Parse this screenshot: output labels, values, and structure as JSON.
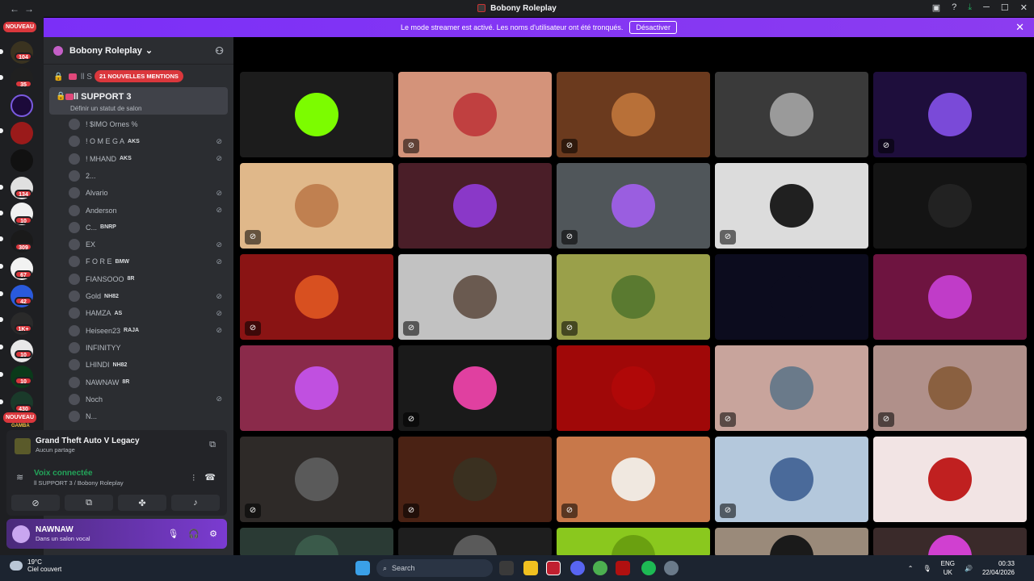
{
  "window": {
    "title": "Bobony Roleplay",
    "back": "←",
    "forward": "→"
  },
  "banner": {
    "text": "Le mode streamer est activé. Les noms d'utilisateur ont été tronqués.",
    "button": "Désactiver",
    "close": "✕"
  },
  "guilds": {
    "badges": [
      "104",
      "35",
      "134",
      "10",
      "309",
      "67",
      "42",
      "1K+",
      "10",
      "10",
      "430"
    ],
    "new_label_top": "NOUVEAU",
    "new_label_bottom": "NOUVEAU",
    "gamba_label": "GAMBA"
  },
  "server": {
    "name": "Bobony Roleplay",
    "chevron": "⌄"
  },
  "channels": {
    "truncated_channel": "ll S",
    "mentions_badge": "21 NOUVELLES MENTIONS",
    "active": {
      "name": "ll SUPPORT 3",
      "status_hint": "Définir un statut de salon"
    }
  },
  "users": [
    {
      "name": "! $IMO Ornes %",
      "tag": ""
    },
    {
      "name": "! O M E G A",
      "tag": "AKS"
    },
    {
      "name": "! MHAND",
      "tag": "AKS"
    },
    {
      "name": "2...",
      "tag": ""
    },
    {
      "name": "Alvario",
      "tag": ""
    },
    {
      "name": "Anderson",
      "tag": ""
    },
    {
      "name": "C...",
      "tag": "BNRP"
    },
    {
      "name": "EX",
      "tag": ""
    },
    {
      "name": "F O R E",
      "tag": "BMW"
    },
    {
      "name": "FIANSOOO",
      "tag": "8R"
    },
    {
      "name": "Gold",
      "tag": "NH82"
    },
    {
      "name": "HAMZA",
      "tag": "AS"
    },
    {
      "name": "Heiseen23",
      "tag": "RAJA"
    },
    {
      "name": "INFINITYY",
      "tag": ""
    },
    {
      "name": "LHINDI",
      "tag": "NH82"
    },
    {
      "name": "NAWNAW",
      "tag": "8R"
    },
    {
      "name": "Noch",
      "tag": ""
    },
    {
      "name": "N...",
      "tag": ""
    }
  ],
  "activity": {
    "game": "Grand Theft Auto V Legacy",
    "sharing": "Aucun partage"
  },
  "voice": {
    "status": "Voix connectée",
    "location": "ll SUPPORT 3 / Bobony Roleplay"
  },
  "current_user": {
    "name": "NAWNAW",
    "status": "Dans un salon vocal"
  },
  "taskbar": {
    "temperature": "19°C",
    "weather": "Ciel couvert",
    "search_placeholder": "Search",
    "lang_line1": "ENG",
    "lang_line2": "UK",
    "time": "00:33",
    "date": "22/04/2026"
  },
  "tiles": [
    {
      "bg": "#1c1c1c",
      "av": "#7cfc00",
      "muted": false
    },
    {
      "bg": "#d4937a",
      "av": "#c04040",
      "muted": true
    },
    {
      "bg": "#6b3a1e",
      "av": "#b87038",
      "muted": true
    },
    {
      "bg": "#3a3a3a",
      "av": "#9a9a9a",
      "muted": false
    },
    {
      "bg": "#1e0e3c",
      "av": "#7a4ad8",
      "muted": true
    },
    {
      "bg": "#e0b88a",
      "av": "#c08050",
      "muted": true
    },
    {
      "bg": "#4a1e28",
      "av": "#8a38c8",
      "muted": false
    },
    {
      "bg": "#50565a",
      "av": "#9a5ee0",
      "muted": true
    },
    {
      "bg": "#dcdcdc",
      "av": "#202020",
      "muted": true
    },
    {
      "bg": "#141414",
      "av": "#222222",
      "muted": false
    },
    {
      "bg": "#8a1414",
      "av": "#d85020",
      "muted": true
    },
    {
      "bg": "#c2c2c2",
      "av": "#6a5a50",
      "muted": true
    },
    {
      "bg": "#9aa04a",
      "av": "#5a7a30",
      "muted": true
    },
    {
      "bg": "#0c0c1e",
      "av": "#0c0c1e",
      "muted": false
    },
    {
      "bg": "#6e1440",
      "av": "#c03cc8",
      "muted": false
    },
    {
      "bg": "#8a2a4a",
      "av": "#c050e0",
      "muted": false
    },
    {
      "bg": "#1a1a1a",
      "av": "#e040a0",
      "muted": true
    },
    {
      "bg": "#a00808",
      "av": "#b00808",
      "muted": false
    },
    {
      "bg": "#c8a49c",
      "av": "#6a7a8a",
      "muted": true
    },
    {
      "bg": "#b0908a",
      "av": "#8a6040",
      "muted": true
    },
    {
      "bg": "#2e2a28",
      "av": "#5a5a5a",
      "muted": true
    },
    {
      "bg": "#4a2214",
      "av": "#3a3020",
      "muted": true
    },
    {
      "bg": "#c8784a",
      "av": "#f0e8e0",
      "muted": true
    },
    {
      "bg": "#b4c8dc",
      "av": "#4a6a9a",
      "muted": true
    },
    {
      "bg": "#f2e4e4",
      "av": "#c02020",
      "muted": false
    },
    {
      "bg": "#2a3a34",
      "av": "#3a5a4a",
      "muted": false
    },
    {
      "bg": "#1e1e1e",
      "av": "#5a5a5a",
      "muted": false
    },
    {
      "bg": "#8ac81e",
      "av": "#6aa010",
      "muted": false
    },
    {
      "bg": "#9a8a7a",
      "av": "#1a1a1a",
      "muted": false
    },
    {
      "bg": "#3a2a2a",
      "av": "#d040d0",
      "muted": false
    }
  ]
}
